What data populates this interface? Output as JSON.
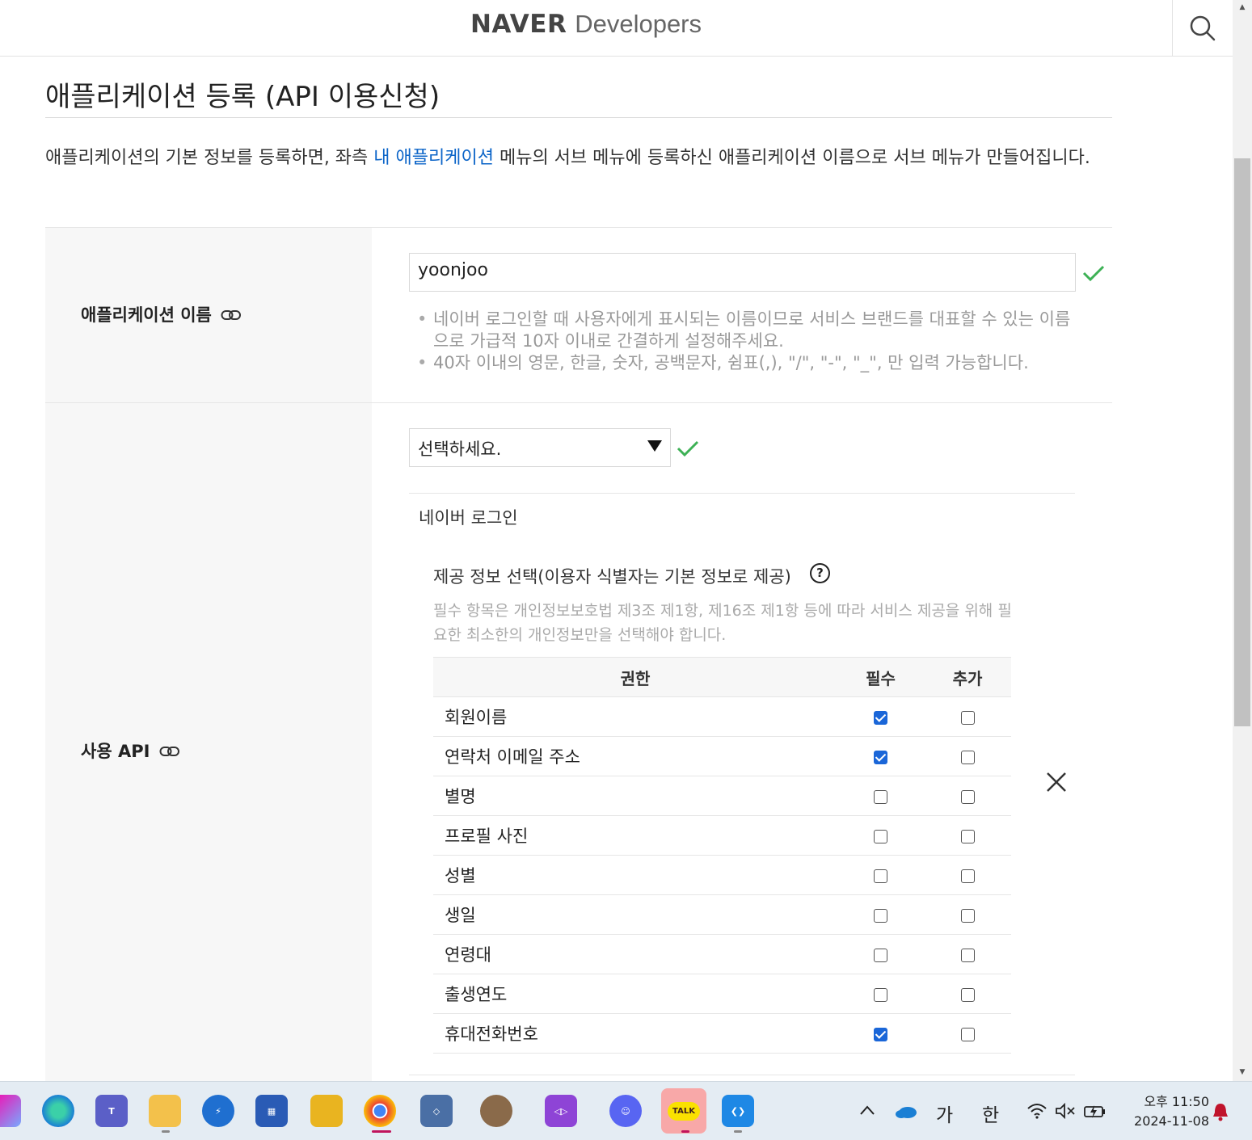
{
  "header": {
    "logo_bold": "NAVER",
    "logo_light": "Developers",
    "search_icon": "search-icon"
  },
  "page": {
    "title": "애플리케이션 등록 (API 이용신청)",
    "intro_before": "애플리케이션의 기본 정보를 등록하면, 좌측 ",
    "intro_link": "내 애플리케이션",
    "intro_after": " 메뉴의 서브 메뉴에 등록하신 애플리케이션 이름으로 서브 메뉴가 만들어집니다."
  },
  "app_name": {
    "label": "애플리케이션 이름",
    "value": "yoonjoo",
    "hints": [
      "네이버 로그인할 때 사용자에게 표시되는 이름이므로 서비스 브랜드를 대표할 수 있는 이름으로 가급적 10자 이내로 간결하게 설정해주세요.",
      "40자 이내의 영문, 한글, 숫자, 공백문자, 쉼표(,), \"/\", \"-\", \"_\", 만 입력 가능합니다."
    ]
  },
  "api": {
    "label": "사용 API",
    "select_value": "선택하세요.",
    "api_name": "네이버 로그인",
    "info_title": "제공 정보 선택(이용자 식별자는 기본 정보로 제공)",
    "help_glyph": "?",
    "info_desc": "필수 항목은 개인정보보호법 제3조 제1항, 제16조 제1항 등에 따라 서비스 제공을 위해 필요한 최소한의 개인정보만을 선택해야 합니다.",
    "table_headers": {
      "permission": "권한",
      "required": "필수",
      "optional": "추가"
    },
    "permissions": [
      {
        "name": "회원이름",
        "required": true,
        "optional": false
      },
      {
        "name": "연락처 이메일 주소",
        "required": true,
        "optional": false
      },
      {
        "name": "별명",
        "required": false,
        "optional": false
      },
      {
        "name": "프로필 사진",
        "required": false,
        "optional": false
      },
      {
        "name": "성별",
        "required": false,
        "optional": false
      },
      {
        "name": "생일",
        "required": false,
        "optional": false
      },
      {
        "name": "연령대",
        "required": false,
        "optional": false
      },
      {
        "name": "출생연도",
        "required": false,
        "optional": false
      },
      {
        "name": "휴대전화번호",
        "required": true,
        "optional": false
      }
    ]
  },
  "colors": {
    "link": "#0b64c8",
    "check_green": "#3db155",
    "checkbox_blue": "#1a66d8"
  },
  "taskbar": {
    "tray_ime_1": "가",
    "tray_ime_2": "한",
    "clock_ampm_time": "오후 11:50",
    "clock_date": "2024-11-08",
    "kakao_label": "TALK"
  }
}
